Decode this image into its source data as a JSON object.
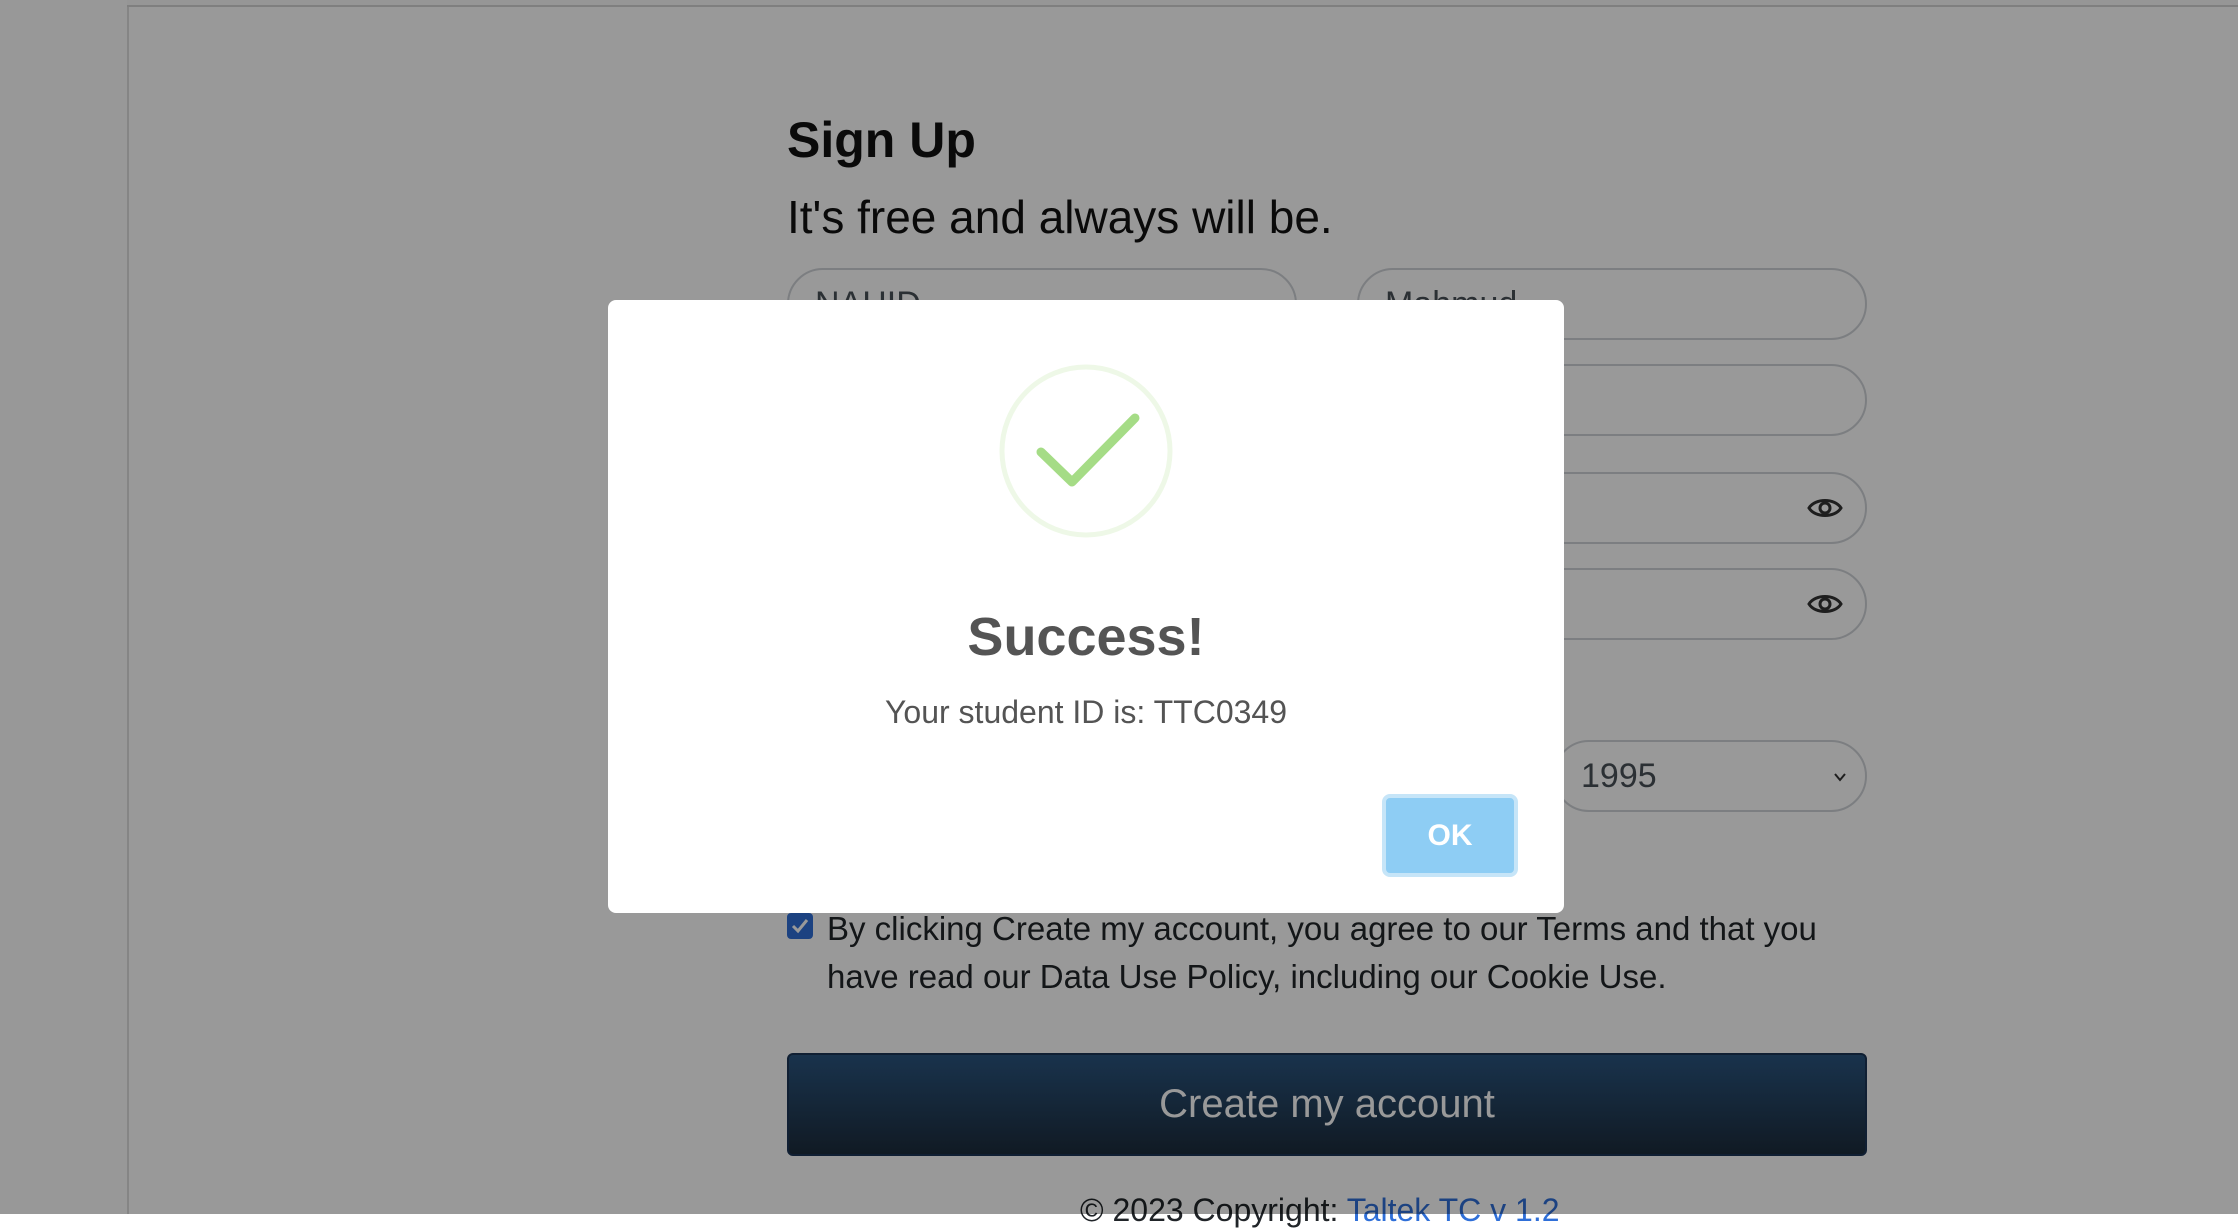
{
  "signup": {
    "title": "Sign Up",
    "subtitle": "It's free and always will be.",
    "first_name_value": "NAHID",
    "last_name_value": "Mahmud",
    "year_value": "1995",
    "terms_text": "By clicking Create my account, you agree to our Terms and that you have read our Data Use Policy, including our Cookie Use.",
    "terms_checked": true,
    "create_button_label": "Create my account"
  },
  "footer": {
    "copyright_prefix": "© 2023 Copyright:",
    "link_text": "Taltek TC v 1.2"
  },
  "modal": {
    "title": "Success!",
    "message": "Your student ID is: TTC0349",
    "ok_label": "OK",
    "icon": "success-check-icon",
    "check_color": "#a5dc86"
  },
  "colors": {
    "ok_button": "#8ecdf4",
    "checkbox": "#2f6fd8",
    "create_button": "#1c2c3c",
    "link": "#2f6fd8"
  }
}
